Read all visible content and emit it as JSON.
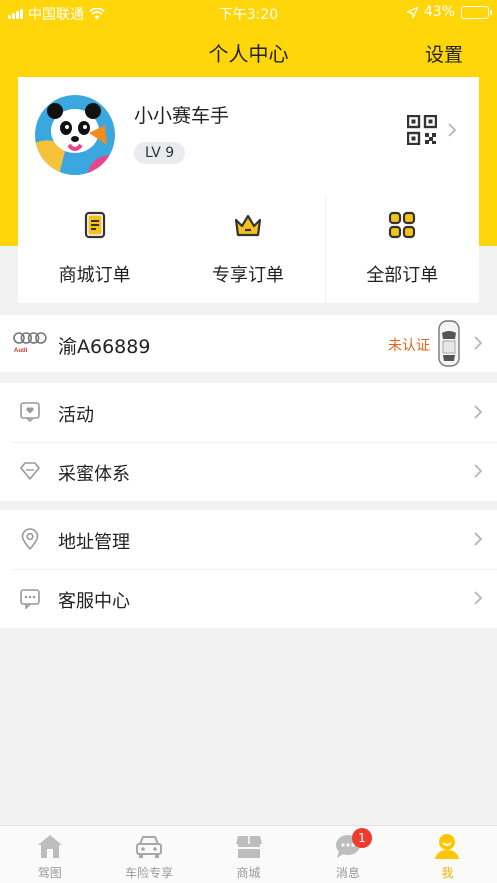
{
  "status_bar": {
    "carrier": "中国联通",
    "time": "下午3:20",
    "battery": "43%"
  },
  "header": {
    "title": "个人中心",
    "settings_label": "设置"
  },
  "profile": {
    "username": "小小赛车手",
    "level": "LV 9"
  },
  "orders": [
    {
      "label": "商城订单",
      "icon": "mall-order-icon"
    },
    {
      "label": "专享订单",
      "icon": "crown-icon"
    },
    {
      "label": "全部订单",
      "icon": "grid-icon"
    }
  ],
  "car": {
    "brand_text": "Audi",
    "plate": "渝A66889",
    "cert_status": "未认证"
  },
  "menu_group_1": [
    {
      "label": "活动",
      "icon": "activity-icon"
    },
    {
      "label": "采蜜体系",
      "icon": "diamond-icon"
    }
  ],
  "menu_group_2": [
    {
      "label": "地址管理",
      "icon": "location-pin-icon"
    },
    {
      "label": "客服中心",
      "icon": "chat-bubble-icon"
    }
  ],
  "tabs": [
    {
      "label": "驾图",
      "icon": "home-icon"
    },
    {
      "label": "车险专享",
      "icon": "car-icon"
    },
    {
      "label": "商城",
      "icon": "store-icon"
    },
    {
      "label": "消息",
      "icon": "message-icon",
      "badge": "1"
    },
    {
      "label": "我",
      "icon": "profile-icon",
      "active": true
    }
  ],
  "colors": {
    "brand_yellow": "#ffd60a",
    "cert_orange": "#e8621a",
    "badge_red": "#f2392e",
    "tab_active": "#f0b300"
  }
}
